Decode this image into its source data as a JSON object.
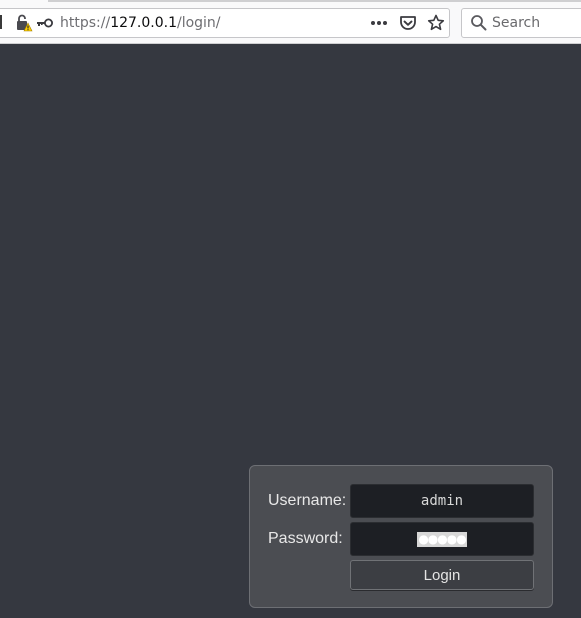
{
  "browser": {
    "url": {
      "scheme": "https://",
      "host": "127.0.0.1",
      "path": "/login/"
    },
    "search_placeholder": "Search",
    "icons": [
      "lock-warning-icon",
      "key-icon",
      "more-actions-icon",
      "pocket-icon",
      "bookmark-star-icon",
      "search-icon"
    ]
  },
  "login": {
    "username_label": "Username:",
    "password_label": "Password:",
    "username_value": "admin",
    "password_value": "●●●●●",
    "button_label": "Login"
  },
  "colors": {
    "page_background": "#353840",
    "panel_background": "#4b4d52",
    "field_background": "#1d1f24"
  }
}
